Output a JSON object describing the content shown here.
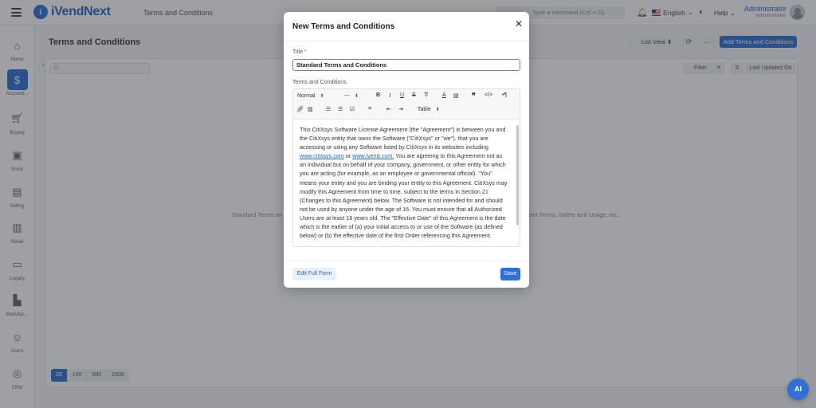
{
  "app": {
    "logo_mark": "i",
    "logo_text": "iVendNext",
    "breadcrumb": "Terms and Conditions",
    "search_placeholder": "Type a command (Ctrl + G)",
    "language": "English",
    "help": "Help",
    "user_name": "Administrator",
    "user_role": "Administrator"
  },
  "sidebar": {
    "items": [
      {
        "label": "Home",
        "icon": "home-icon"
      },
      {
        "label": "Accounti...",
        "icon": "dollar-icon"
      },
      {
        "label": "Buying",
        "icon": "cart-icon"
      },
      {
        "label": "Stock",
        "icon": "box-icon"
      },
      {
        "label": "Selling",
        "icon": "register-icon"
      },
      {
        "label": "Retail",
        "icon": "barcode-icon"
      },
      {
        "label": "Loyalty",
        "icon": "card-icon"
      },
      {
        "label": "Manufac...",
        "icon": "factory-icon"
      },
      {
        "label": "Users",
        "icon": "users-icon"
      },
      {
        "label": "CRM",
        "icon": "crm-icon"
      }
    ]
  },
  "page": {
    "title": "Terms and Conditions",
    "list_view": "List View",
    "add_button": "Add Terms and Conditions",
    "id_placeholder": "ID",
    "filter": "Filter",
    "sort_label": "Last Updated On",
    "empty_left": "Standard Terms an",
    "empty_right": "ent Terms, Safety and Usage, etc.",
    "page_sizes": [
      "20",
      "100",
      "500",
      "2500"
    ],
    "ai_label": "AI"
  },
  "modal": {
    "title": "New Terms and Conditions",
    "title_label": "Title",
    "title_required": "*",
    "title_value": "Standard Terms and Conditions",
    "tc_label": "Terms and Conditions",
    "toolbar": {
      "heading": "Normal",
      "size": "---",
      "table": "Table"
    },
    "content": {
      "p1": "This CitiXsys Software License Agreement (the \"Agreement\") is between you and the CitiXsys entity that owns the Software (\"CitiXsys\" or \"we\"). that you are accessing or using any Software listed by CitiXsys in its websites including ",
      "link1": "www.citixsys.com",
      "or": " or ",
      "link2": "www.ivend.com.",
      "p2": " You are agreeing to this Agreement not as an individual but on behalf of your company, government, or other entity for which you are acting (for example, as an employee or governmental official). \"You\" means your entity and you are binding your entity to this Agreement. CitiXsys may modify this Agreement from time to time, subject to the terms in Section 21 (Changes to this Agreement) below. The Software is not intended for and should not be used by anyone under the age of 16. You must ensure that all Authorized Users are at least 16 years old. The \"Effective Date\" of this Agreement is the date which is the earlier of (a) your initial access to or use of the Software (as defined below) or (b) the effective date of the first Order referencing this Agreement."
    },
    "edit_full_form": "Edit Full Form",
    "save": "Save"
  }
}
